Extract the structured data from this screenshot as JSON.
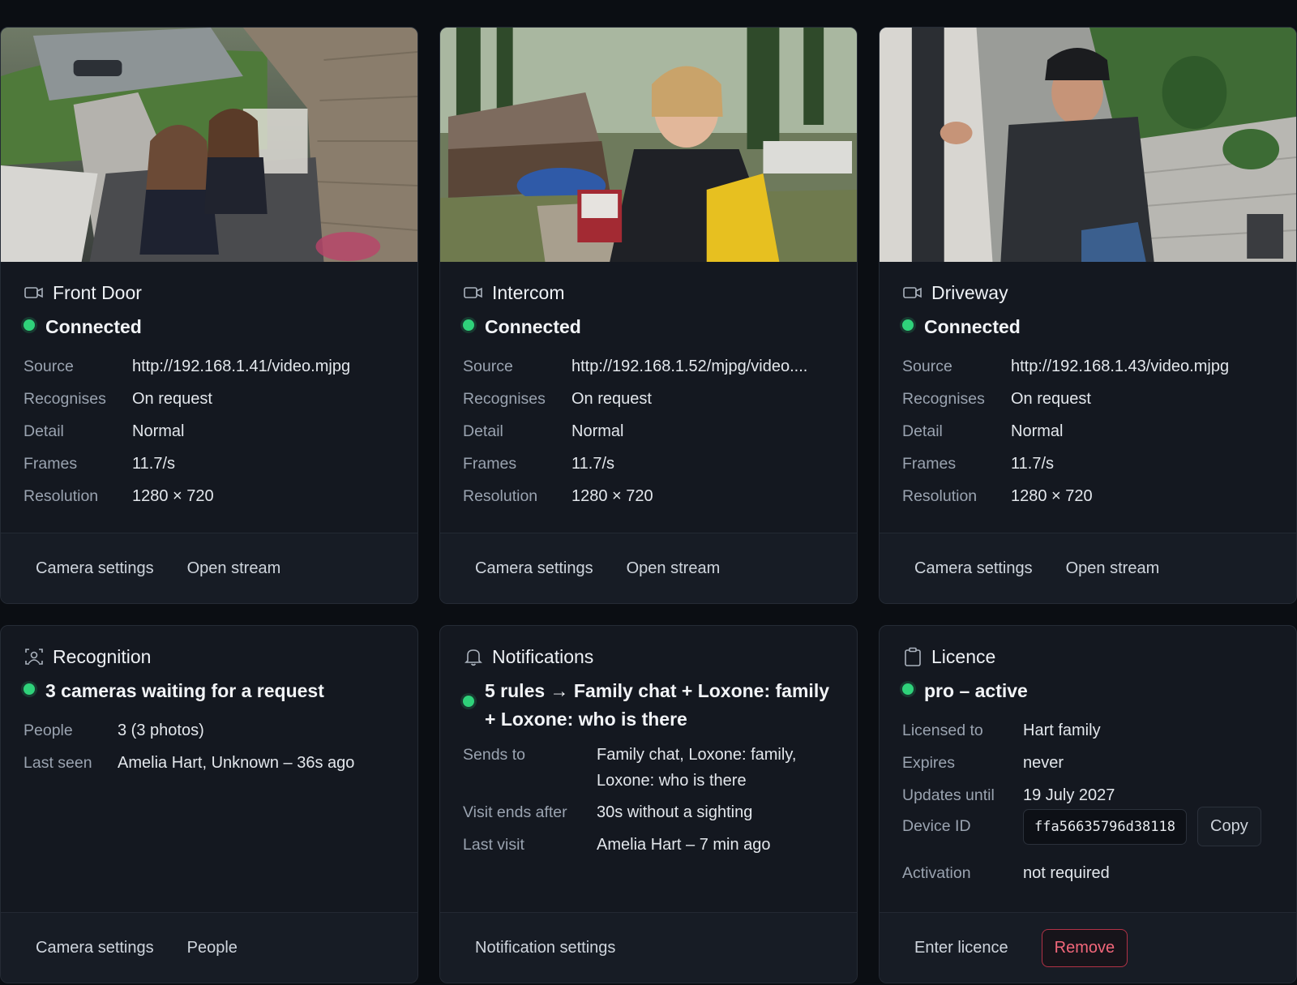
{
  "cameras": [
    {
      "title": "Front Door",
      "status": "Connected",
      "fields": [
        {
          "key": "Source",
          "value": "http://192.168.1.41/video.mjpg"
        },
        {
          "key": "Recognises",
          "value": "On request"
        },
        {
          "key": "Detail",
          "value": "Normal"
        },
        {
          "key": "Frames",
          "value": "11.7/s"
        },
        {
          "key": "Resolution",
          "value": "1280 × 720"
        }
      ],
      "actions": [
        "Camera settings",
        "Open stream"
      ]
    },
    {
      "title": "Intercom",
      "status": "Connected",
      "fields": [
        {
          "key": "Source",
          "value": "http://192.168.1.52/mjpg/video...."
        },
        {
          "key": "Recognises",
          "value": "On request"
        },
        {
          "key": "Detail",
          "value": "Normal"
        },
        {
          "key": "Frames",
          "value": "11.7/s"
        },
        {
          "key": "Resolution",
          "value": "1280 × 720"
        }
      ],
      "actions": [
        "Camera settings",
        "Open stream"
      ]
    },
    {
      "title": "Driveway",
      "status": "Connected",
      "fields": [
        {
          "key": "Source",
          "value": "http://192.168.1.43/video.mjpg"
        },
        {
          "key": "Recognises",
          "value": "On request"
        },
        {
          "key": "Detail",
          "value": "Normal"
        },
        {
          "key": "Frames",
          "value": "11.7/s"
        },
        {
          "key": "Resolution",
          "value": "1280 × 720"
        }
      ],
      "actions": [
        "Camera settings",
        "Open stream"
      ]
    }
  ],
  "recognition": {
    "title": "Recognition",
    "status": "3 cameras waiting for a request",
    "fields": [
      {
        "key": "People",
        "value": "3 (3 photos)"
      },
      {
        "key": "Last seen",
        "value": "Amelia Hart, Unknown – 36s ago"
      }
    ],
    "actions": [
      "Camera settings",
      "People"
    ]
  },
  "notifications": {
    "title": "Notifications",
    "status": "5 rules → Family chat + Loxone: family + Loxone: who is there",
    "fields": [
      {
        "key": "Sends to",
        "value": "Family chat, Loxone: family, Loxone: who is there"
      },
      {
        "key": "Visit ends after",
        "value": "30s without a sighting"
      },
      {
        "key": "Last visit",
        "value": "Amelia Hart – 7 min ago"
      }
    ],
    "actions": [
      "Notification settings"
    ]
  },
  "licence": {
    "title": "Licence",
    "status": "pro – active",
    "licensed_to_label": "Licensed to",
    "licensed_to": "Hart family",
    "expires_label": "Expires",
    "expires": "never",
    "updates_label": "Updates until",
    "updates": "19 July 2027",
    "device_id_label": "Device ID",
    "device_id": "ffa56635796d38118",
    "copy_label": "Copy",
    "activation_label": "Activation",
    "activation": "not required",
    "enter_label": "Enter licence",
    "remove_label": "Remove"
  },
  "colors": {
    "background": "#0b0e13",
    "card": "#141820",
    "status_ok": "#2fd27a",
    "danger": "#f2677a"
  }
}
